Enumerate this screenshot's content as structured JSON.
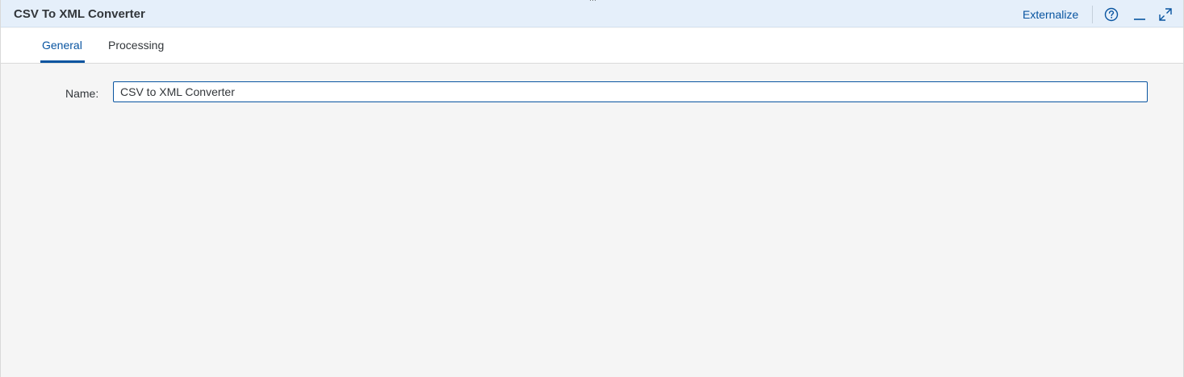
{
  "header": {
    "title": "CSV To XML Converter",
    "externalize_label": "Externalize",
    "icons": [
      "help-icon",
      "minimize-icon",
      "maximize-icon"
    ],
    "drag_handle": "⋯"
  },
  "tabs": [
    {
      "label": "General",
      "active": true
    },
    {
      "label": "Processing",
      "active": false
    }
  ],
  "form": {
    "name_label": "Name:",
    "name_value": "CSV to XML Converter"
  },
  "colors": {
    "accent": "#0854a0",
    "titlebar_bg": "#e5effa",
    "content_bg": "#f5f5f5"
  }
}
